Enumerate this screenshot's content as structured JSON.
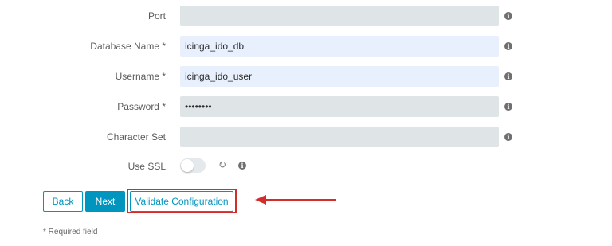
{
  "form": {
    "fields": [
      {
        "label": "Port",
        "value": "",
        "placeholder": ""
      },
      {
        "label": "Database Name *",
        "value": "icinga_ido_db",
        "placeholder": ""
      },
      {
        "label": "Username *",
        "value": "icinga_ido_user",
        "placeholder": ""
      },
      {
        "label": "Password *",
        "value": "••••••••",
        "placeholder": ""
      },
      {
        "label": "Character Set",
        "value": "",
        "placeholder": ""
      }
    ],
    "ssl": {
      "label": "Use SSL",
      "enabled": false
    }
  },
  "buttons": {
    "back": "Back",
    "next": "Next",
    "validate": "Validate Configuration"
  },
  "footer": {
    "required_note": "* Required field"
  },
  "icons": {
    "info": "info-icon",
    "reset": "reset-icon"
  },
  "colors": {
    "accent": "#0095bf",
    "annotation": "#d42b2b",
    "field_empty": "#dfe4e6",
    "field_filled": "#e8f0fe"
  }
}
